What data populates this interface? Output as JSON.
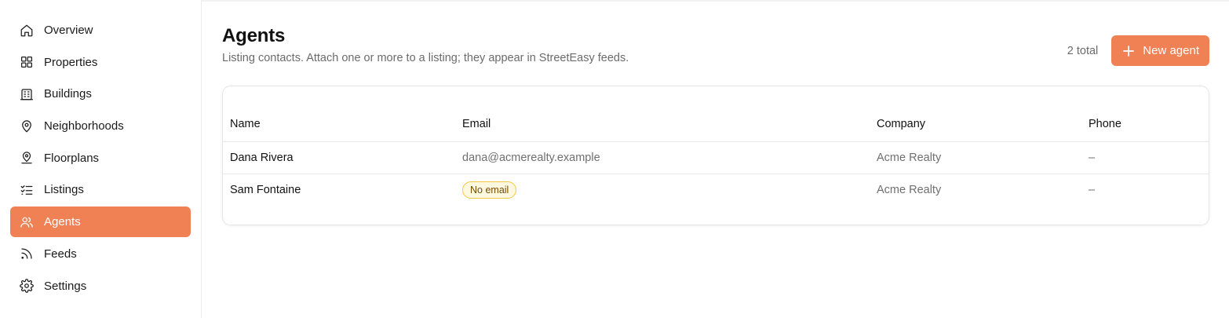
{
  "sidebar": {
    "items": [
      {
        "label": "Overview",
        "icon": "home-icon"
      },
      {
        "label": "Properties",
        "icon": "grid-icon"
      },
      {
        "label": "Buildings",
        "icon": "building-icon"
      },
      {
        "label": "Neighborhoods",
        "icon": "map-pin-icon"
      },
      {
        "label": "Floorplans",
        "icon": "user-pin-icon"
      },
      {
        "label": "Listings",
        "icon": "checklist-icon"
      },
      {
        "label": "Agents",
        "icon": "users-icon",
        "active": true
      },
      {
        "label": "Feeds",
        "icon": "rss-icon"
      },
      {
        "label": "Settings",
        "icon": "gear-icon"
      }
    ]
  },
  "header": {
    "title": "Agents",
    "subtitle": "Listing contacts. Attach one or more to a listing; they appear in StreetEasy feeds.",
    "total": "2 total",
    "new_button": "New agent"
  },
  "table": {
    "columns": [
      "Name",
      "Email",
      "Company",
      "Phone"
    ],
    "rows": [
      {
        "name": "Dana Rivera",
        "email": "dana@acmerealty.example",
        "company": "Acme Realty",
        "phone": "–"
      },
      {
        "name": "Sam Fontaine",
        "email_badge": "No email",
        "company": "Acme Realty",
        "phone": "–"
      }
    ]
  },
  "colors": {
    "accent": "#f08155",
    "badge_bg": "#fff8e1",
    "badge_border": "#f5c842"
  }
}
